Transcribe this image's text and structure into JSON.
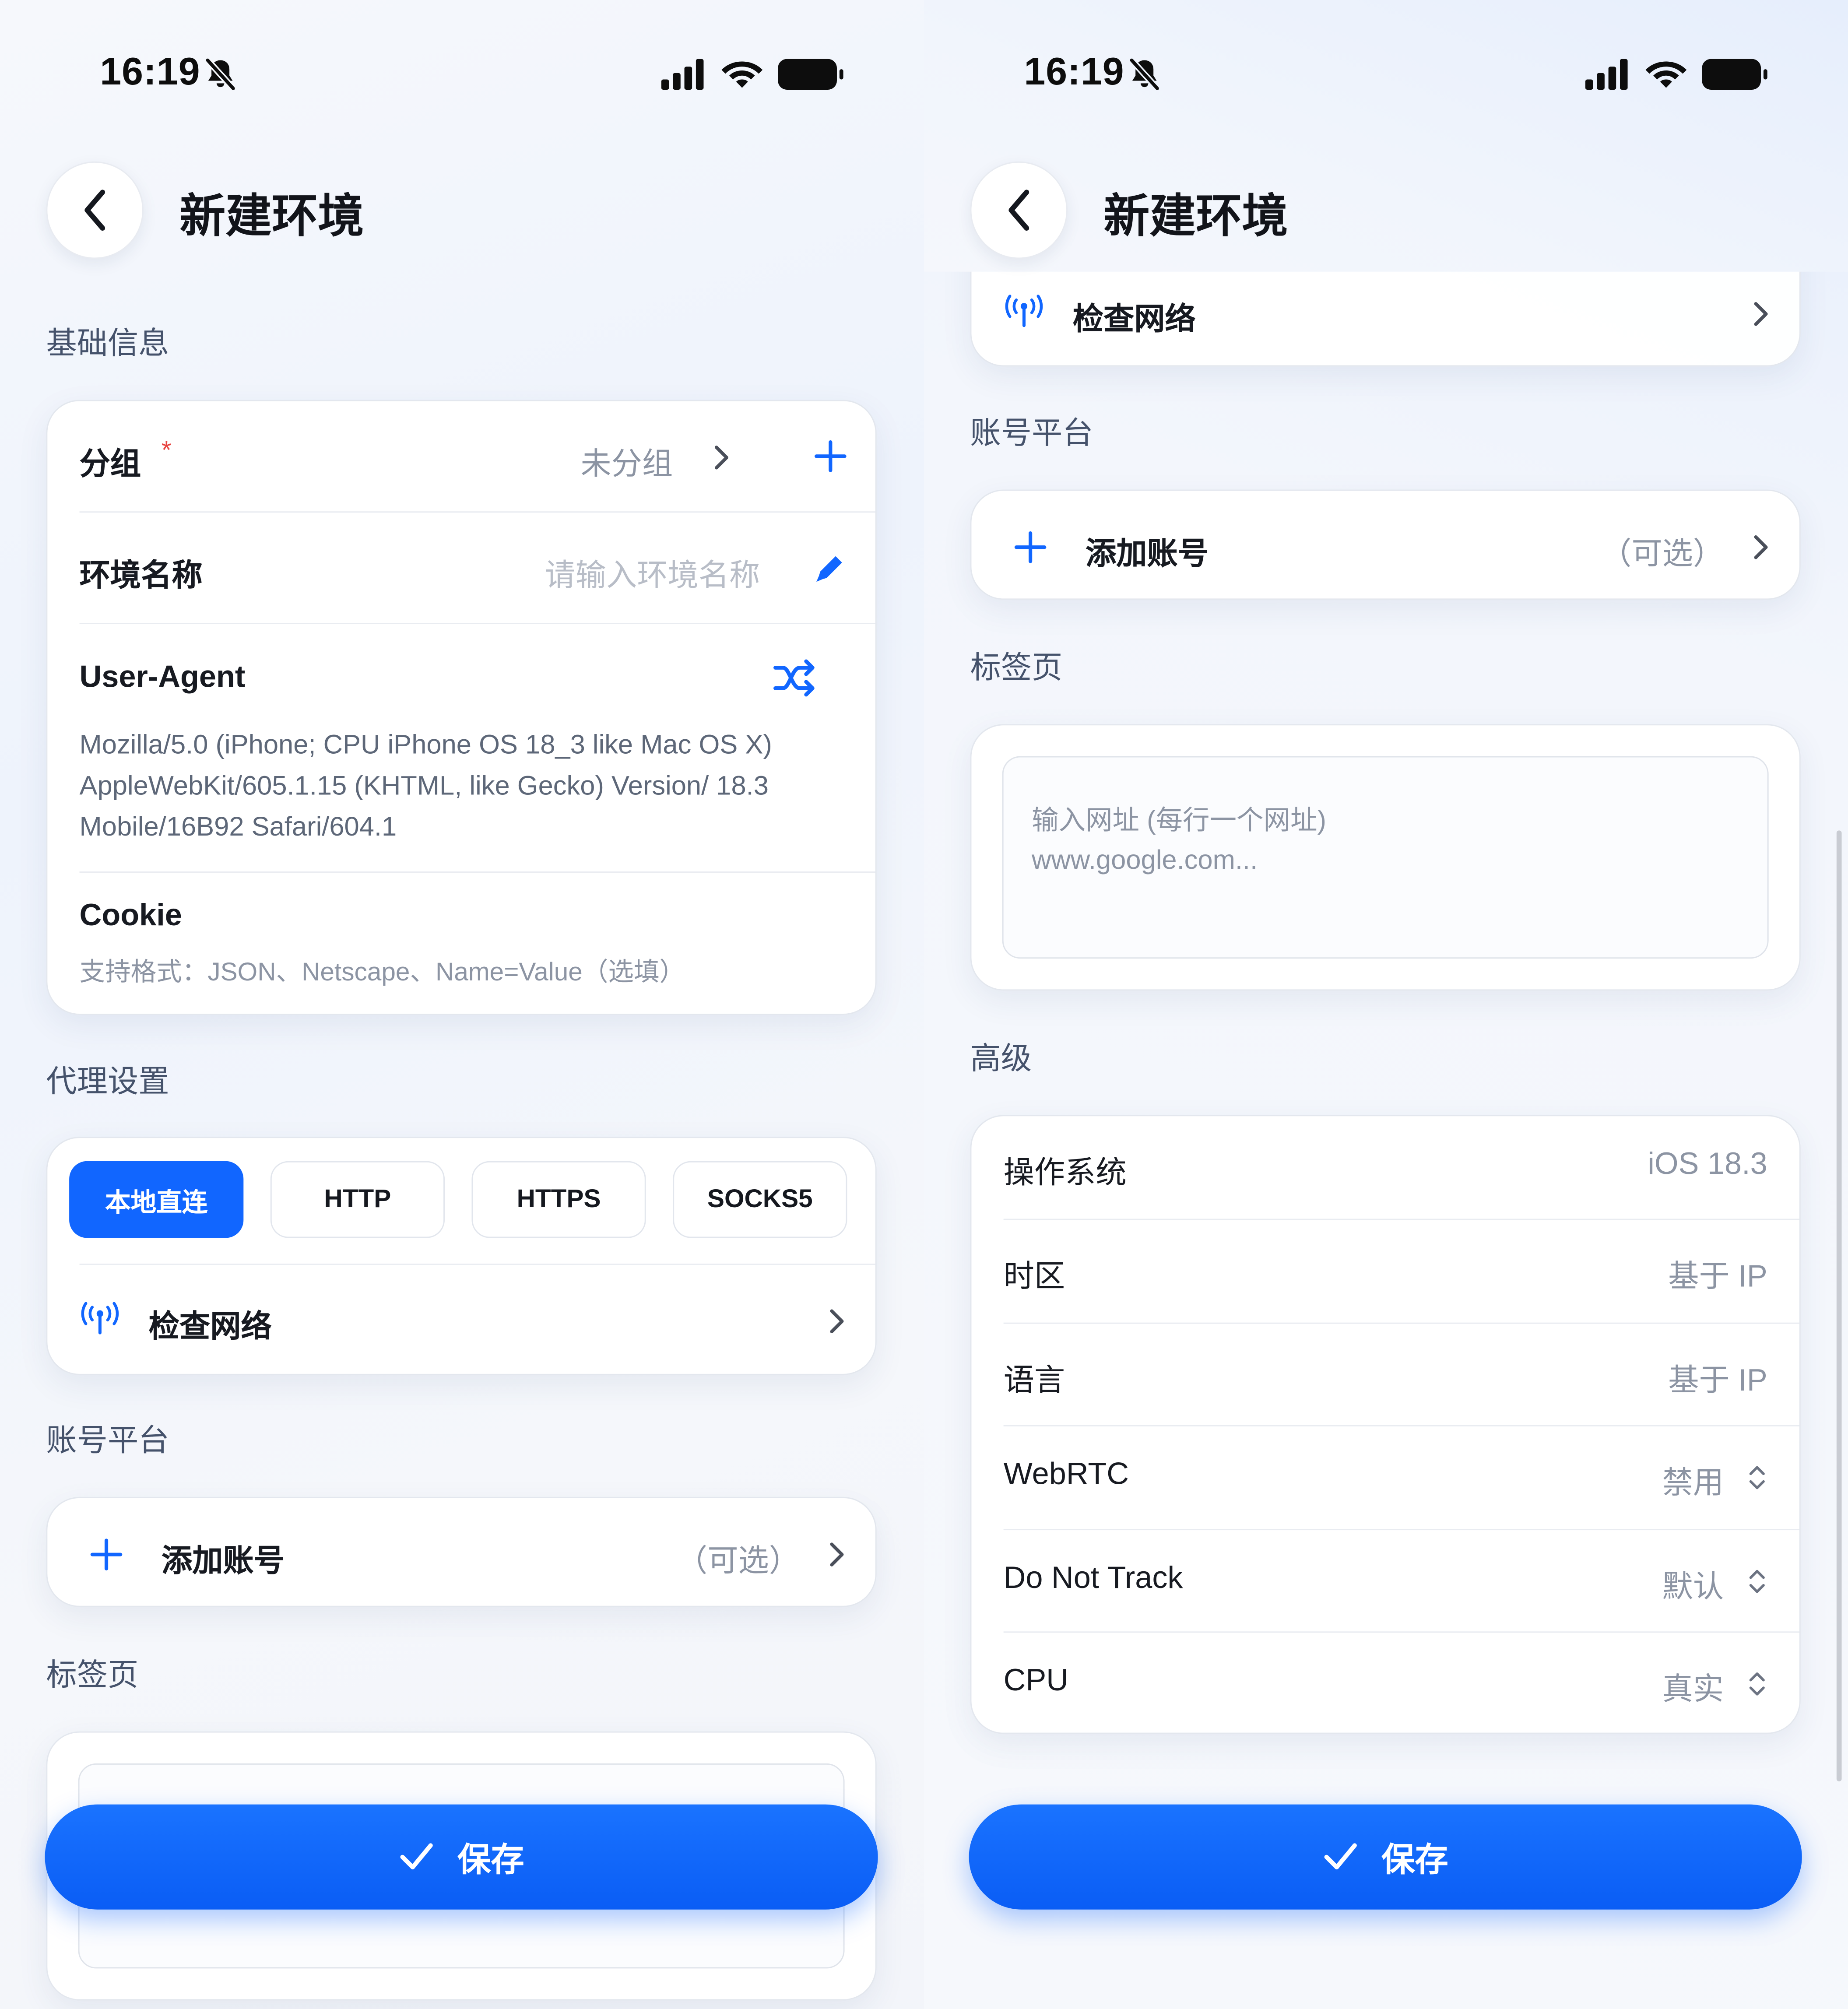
{
  "left": {
    "status": {
      "time": "16:19"
    },
    "header": {
      "title": "新建环境"
    },
    "basic": {
      "section_title": "基础信息",
      "group_label": "分组",
      "group_required": "*",
      "group_value": "未分组",
      "env_name_label": "环境名称",
      "env_name_placeholder": "请输入环境名称",
      "ua_label": "User-Agent",
      "ua_value": "Mozilla/5.0 (iPhone; CPU iPhone OS 18_3 like Mac OS X) AppleWebKit/605.1.15 (KHTML, like Gecko) Version/ 18.3 Mobile/16B92 Safari/604.1",
      "cookie_label": "Cookie",
      "cookie_hint": "支持格式：JSON、Netscape、Name=Value（选填）"
    },
    "proxy": {
      "section_title": "代理设置",
      "options": [
        "本地直连",
        "HTTP",
        "HTTPS",
        "SOCKS5"
      ],
      "selected": "本地直连",
      "check_network": "检查网络"
    },
    "account": {
      "section_title": "账号平台",
      "add_label": "添加账号",
      "optional": "（可选）"
    },
    "tabs": {
      "section_title": "标签页"
    },
    "save_label": "保存"
  },
  "right": {
    "status": {
      "time": "16:19"
    },
    "header": {
      "title": "新建环境"
    },
    "proxy": {
      "check_network": "检查网络"
    },
    "account": {
      "section_title": "账号平台",
      "add_label": "添加账号",
      "optional": "（可选）"
    },
    "tabs": {
      "section_title": "标签页",
      "placeholder_line1": "输入网址 (每行一个网址)",
      "placeholder_line2": "www.google.com..."
    },
    "advanced": {
      "section_title": "高级",
      "rows": [
        {
          "label": "操作系统",
          "value": "iOS 18.3"
        },
        {
          "label": "时区",
          "value": "基于 IP"
        },
        {
          "label": "语言",
          "value": "基于 IP"
        },
        {
          "label": "WebRTC",
          "value": "禁用"
        },
        {
          "label": "Do Not Track",
          "value": "默认"
        },
        {
          "label": "CPU",
          "value": "真实"
        }
      ]
    },
    "save_label": "保存"
  },
  "colors": {
    "accent": "#1166ff",
    "text_primary": "#171a21",
    "text_muted": "#8c94a3",
    "section_title": "#45526b",
    "required": "#e8423f"
  },
  "icons": [
    "mute-bell-icon",
    "signal-icon",
    "wifi-icon",
    "battery-icon",
    "back-chevron-icon",
    "chevron-right-icon",
    "plus-icon",
    "pencil-icon",
    "shuffle-icon",
    "antenna-icon",
    "updown-chevron-icon",
    "checkmark-icon"
  ]
}
